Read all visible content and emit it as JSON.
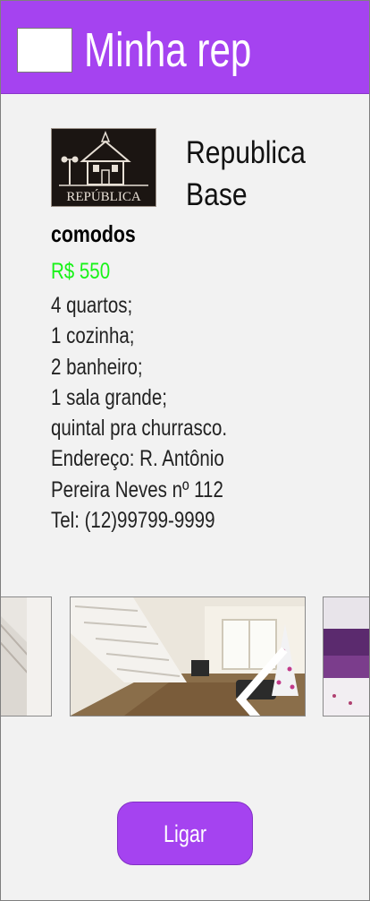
{
  "header": {
    "title": "Minha rep",
    "menu_icon": "blank-menu-box"
  },
  "republic": {
    "name_line1": "Republica",
    "name_line2": "Base",
    "logo_text": "REPÚBLICA"
  },
  "details": {
    "section_title": "comodos",
    "price": "R$ 550",
    "price_color": "#17f317",
    "lines": [
      "4 quartos;",
      "1 cozinha;",
      "2 banheiro;",
      "1 sala grande;",
      "quintal pra churrasco.",
      "Endereço: R. Antônio",
      "Pereira Neves nº 112",
      "Tel: (12)99799-9999"
    ]
  },
  "gallery": {
    "prev_icon": "chevron-left-icon"
  },
  "actions": {
    "call_label": "Ligar"
  },
  "colors": {
    "accent": "#a543f0",
    "background": "#f2f2f2"
  }
}
